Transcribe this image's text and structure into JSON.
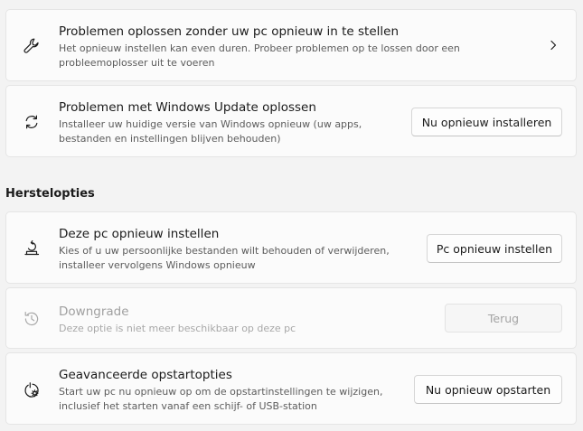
{
  "cards_top": [
    {
      "title": "Problemen oplossen zonder uw pc opnieuw in te stellen",
      "description": "Het opnieuw instellen kan even duren. Probeer problemen op te lossen door een probleemoplosser uit te voeren",
      "icon": "wrench-icon"
    },
    {
      "title": "Problemen met Windows Update oplossen",
      "description": "Installeer uw huidige versie van Windows opnieuw (uw apps, bestanden en instellingen blijven behouden)",
      "button": "Nu opnieuw installeren",
      "icon": "sync-icon"
    }
  ],
  "section": {
    "title": "Herstelopties"
  },
  "recovery": [
    {
      "title": "Deze pc opnieuw instellen",
      "description": "Kies of u uw persoonlijke bestanden wilt behouden of verwijderen, installeer vervolgens Windows opnieuw",
      "button": "Pc opnieuw instellen",
      "icon": "reset-pc-icon"
    },
    {
      "title": "Downgrade",
      "description": "Deze optie is niet meer beschikbaar op deze pc",
      "button": "Terug",
      "disabled": true,
      "icon": "history-icon"
    },
    {
      "title": "Geavanceerde opstartopties",
      "description": "Start uw pc nu opnieuw op om de opstartinstellingen te wijzigen, inclusief het starten vanaf een schijf- of USB-station",
      "button": "Nu opnieuw opstarten",
      "icon": "advanced-startup-icon"
    }
  ]
}
